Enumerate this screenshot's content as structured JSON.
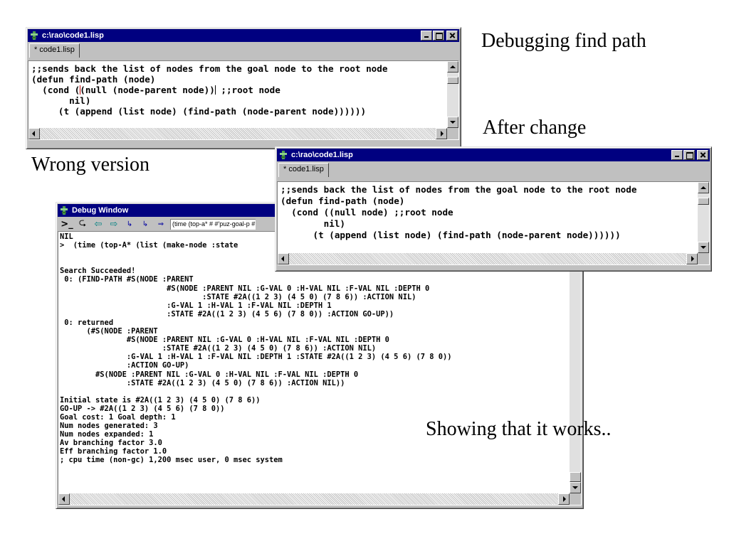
{
  "captions": {
    "debugging": "Debugging find path",
    "after_change": "After change",
    "wrong_version": "Wrong version",
    "showing": "Showing that it works.."
  },
  "editor_window_1": {
    "title": "c:\\rao\\code1.lisp",
    "tab": "* code1.lisp",
    "lines": [
      ";;sends back the list of nodes from the goal node to the root node",
      "(defun find-path (node)",
      "  (cond (",
      "(null (node-parent node))",
      " ;;root node",
      "       nil)",
      "     (t (append (list node) (find-path (node-parent node))))))"
    ]
  },
  "editor_window_2": {
    "title": "c:\\rao\\code1.lisp",
    "tab": "* code1.lisp",
    "lines": [
      ";;sends back the list of nodes from the goal node to the root node",
      "(defun find-path (node)",
      "  (cond ((null node) ;;root node",
      "        nil)",
      "      (t (append (list node) (find-path (node-parent node))))))"
    ]
  },
  "debug_window": {
    "title": "Debug Window",
    "toolbar_input": "(time (top-a* # #'puz-goal-p #",
    "lines": [
      "NIL",
      ">  (time (top-A* (list (make-node :state",
      "",
      "",
      "Search Succeeded!",
      " 0: (FIND-PATH #S(NODE :PARENT",
      "                        #S(NODE :PARENT NIL :G-VAL 0 :H-VAL NIL :F-VAL NIL :DEPTH 0",
      "                                :STATE #2A((1 2 3) (4 5 0) (7 8 6)) :ACTION NIL)",
      "                        :G-VAL 1 :H-VAL 1 :F-VAL NIL :DEPTH 1",
      "                        :STATE #2A((1 2 3) (4 5 6) (7 8 0)) :ACTION GO-UP))",
      " 0: returned",
      "      (#S(NODE :PARENT",
      "               #S(NODE :PARENT NIL :G-VAL 0 :H-VAL NIL :F-VAL NIL :DEPTH 0",
      "                       :STATE #2A((1 2 3) (4 5 0) (7 8 6)) :ACTION NIL)",
      "               :G-VAL 1 :H-VAL 1 :F-VAL NIL :DEPTH 1 :STATE #2A((1 2 3) (4 5 6) (7 8 0))",
      "               :ACTION GO-UP)",
      "        #S(NODE :PARENT NIL :G-VAL 0 :H-VAL NIL :F-VAL NIL :DEPTH 0",
      "               :STATE #2A((1 2 3) (4 5 0) (7 8 6)) :ACTION NIL))",
      "",
      "Initial state is #2A((1 2 3) (4 5 0) (7 8 6))",
      "GO-UP -> #2A((1 2 3) (4 5 6) (7 8 0))",
      "Goal cost: 1 Goal depth: 1",
      "Num nodes generated: 3",
      "Num nodes expanded: 1",
      "Av branching factor 3.0",
      "Eff branching factor 1.0",
      "; cpu time (non-gc) 1,200 msec user, 0 msec system"
    ]
  },
  "icons": {
    "title_icon": "app-icon",
    "toolbar": [
      "prompt-icon",
      "step-icon",
      "back-arrow-icon",
      "forward-arrow-icon",
      "step-over-icon",
      "step-into-icon",
      "step-out-icon"
    ]
  },
  "colors": {
    "titlebar": "#000080",
    "window_face": "#c0c0c0",
    "cursor_red": "#c00000"
  }
}
